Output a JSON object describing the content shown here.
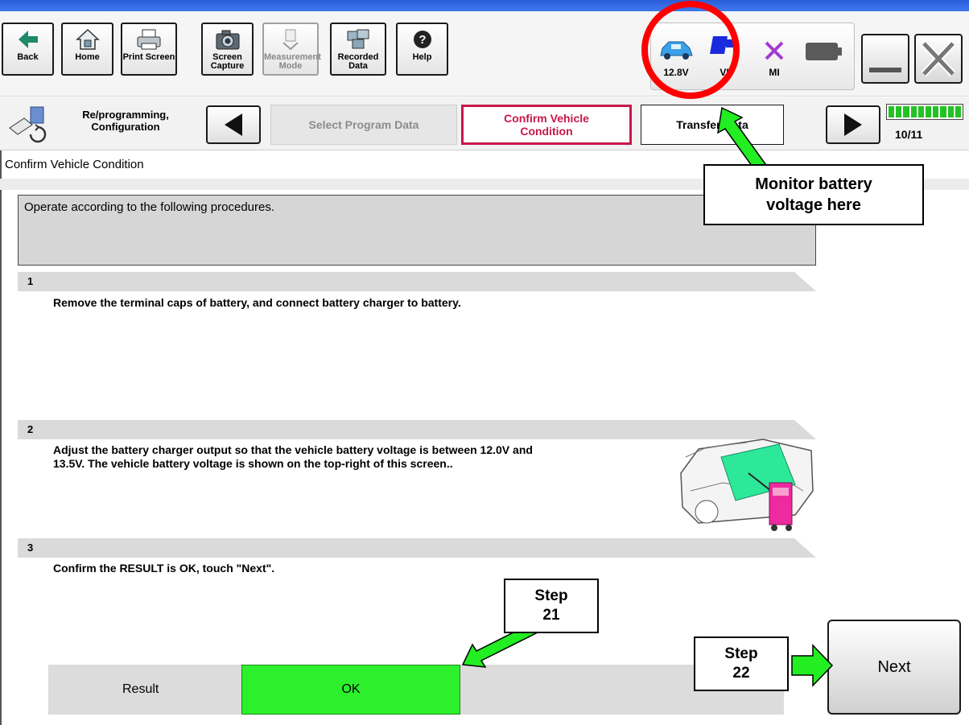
{
  "toolbar": {
    "back": "Back",
    "home": "Home",
    "print_screen": "Print Screen",
    "screen_capture": "Screen\nCapture",
    "measurement_mode": "Measurement\nMode",
    "recorded_data": "Recorded\nData",
    "help": "Help"
  },
  "status": {
    "voltage": "12.8V",
    "vi_label": "VI",
    "mi_label": "MI"
  },
  "nav": {
    "mode_label": "Re/programming,\nConfiguration",
    "prev_step": "Select Program Data",
    "current_step": "Confirm Vehicle\nCondition",
    "next_step": "Transfer Data",
    "page": "10/11",
    "progress_fraction": 0.91
  },
  "content": {
    "section_title": "Confirm Vehicle Condition",
    "procedure_header": "Operate according to the following procedures.",
    "steps": [
      {
        "num": "1",
        "text": "Remove the terminal caps of battery, and connect battery charger to battery."
      },
      {
        "num": "2",
        "text": "Adjust the battery charger output so that the vehicle battery voltage is between 12.0V and\n13.5V. The vehicle battery voltage is shown on the top-right of this screen.."
      },
      {
        "num": "3",
        "text": "Confirm the RESULT is OK, touch \"Next\"."
      }
    ],
    "result_label": "Result",
    "result_value": "OK",
    "next_button": "Next"
  },
  "annotations": {
    "monitor": "Monitor battery\nvoltage here",
    "step21": "Step\n21",
    "step22": "Step\n22"
  },
  "colors": {
    "accent": "#c8174a",
    "ok_green": "#2bf02b",
    "arrow_green": "#22ee22",
    "circle_red": "#ff0000"
  }
}
